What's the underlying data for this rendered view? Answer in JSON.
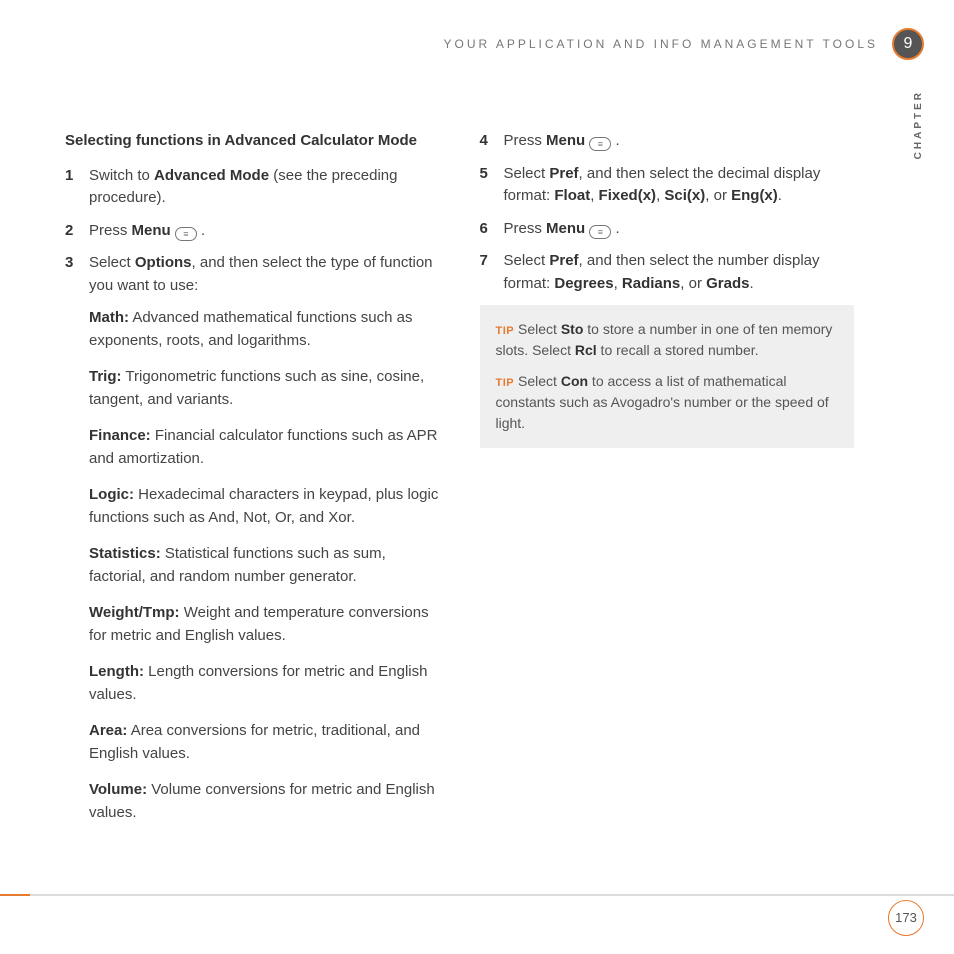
{
  "runningHead": "YOUR APPLICATION AND INFO MANAGEMENT TOOLS",
  "chapterNumber": "9",
  "chapterLabel": "CHAPTER",
  "sectionTitle": "Selecting functions in Advanced Calculator Mode",
  "steps": {
    "s1": {
      "num": "1",
      "pre": "Switch to ",
      "b1": "Advanced Mode",
      "post": " (see the preceding procedure)."
    },
    "s2": {
      "num": "2",
      "pre": "Press ",
      "b1": "Menu",
      "post": " ."
    },
    "s3": {
      "num": "3",
      "pre": "Select ",
      "b1": "Options",
      "post": ", and then select the type of function you want to use:"
    },
    "s4": {
      "num": "4",
      "pre": "Press ",
      "b1": "Menu",
      "post": " ."
    },
    "s5": {
      "num": "5",
      "pre": "Select ",
      "b1": "Pref",
      "mid": ", and then select the decimal display format: ",
      "opts": [
        "Float",
        "Fixed(x)",
        "Sci(x)",
        "Eng(x)"
      ]
    },
    "s6": {
      "num": "6",
      "pre": "Press ",
      "b1": "Menu",
      "post": " ."
    },
    "s7": {
      "num": "7",
      "pre": "Select ",
      "b1": "Pref",
      "mid": ", and then select the number display format: ",
      "opts": [
        "Degrees",
        "Radians",
        "Grads"
      ]
    }
  },
  "funcs": {
    "math": {
      "label": "Math:",
      "desc": " Advanced mathematical functions such as exponents, roots, and logarithms."
    },
    "trig": {
      "label": "Trig:",
      "desc": " Trigonometric functions such as sine, cosine, tangent, and variants."
    },
    "finance": {
      "label": "Finance:",
      "desc": " Financial calculator functions such as APR and amortization."
    },
    "logic": {
      "label": "Logic:",
      "desc": " Hexadecimal characters in keypad, plus logic functions such as And, Not, Or, and Xor."
    },
    "stats": {
      "label": "Statistics:",
      "desc": " Statistical functions such as sum, factorial, and random number generator."
    },
    "weight": {
      "label": "Weight/Tmp:",
      "desc": " Weight and temperature conversions for metric and English values."
    },
    "length": {
      "label": "Length:",
      "desc": " Length conversions for metric and English values."
    },
    "area": {
      "label": "Area:",
      "desc": " Area conversions for metric, traditional, and English values."
    },
    "volume": {
      "label": "Volume:",
      "desc": " Volume conversions for metric and English values."
    }
  },
  "tips": {
    "label": "TIP",
    "t1": {
      "pre": " Select ",
      "b1": "Sto",
      "mid": " to store a number in one of ten memory slots. Select ",
      "b2": "Rcl",
      "post": " to recall a stored number."
    },
    "t2": {
      "pre": " Select ",
      "b1": "Con",
      "post": " to access a list of mathematical constants such as Avogadro's number or the speed of light."
    }
  },
  "sep": {
    "comma": ", ",
    "or": ", or ",
    "period": "."
  },
  "pageNumber": "173"
}
